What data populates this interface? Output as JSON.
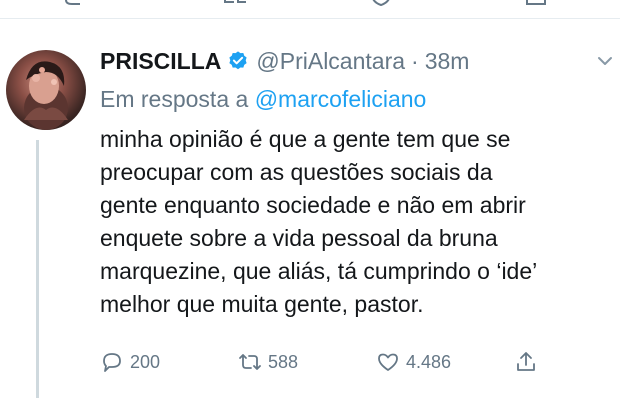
{
  "tweet": {
    "display_name": "PRISCILLA",
    "handle": "@PriAlcantara",
    "separator": "·",
    "time": "38m",
    "reply_prefix": "Em resposta a",
    "reply_mention": "@marcofeliciano",
    "text_lines": [
      "minha opinião é que a gente tem que se",
      "preocupar com as questões sociais da",
      "gente enquanto sociedade e não em abrir",
      "enquete sobre a vida pessoal da bruna",
      "marquezine, que aliás, tá cumprindo o ‘ide’",
      "melhor que muita gente, pastor."
    ],
    "counts": {
      "replies": "200",
      "retweets": "588",
      "likes": "4.486"
    }
  },
  "icons": {
    "verified": "verified-badge-icon",
    "more": "chevron-down-icon",
    "reply": "reply-icon",
    "retweet": "retweet-icon",
    "like": "heart-icon",
    "share": "share-icon"
  },
  "colors": {
    "accent": "#1da1f2",
    "secondary_text": "#657786",
    "primary_text": "#14171a"
  }
}
